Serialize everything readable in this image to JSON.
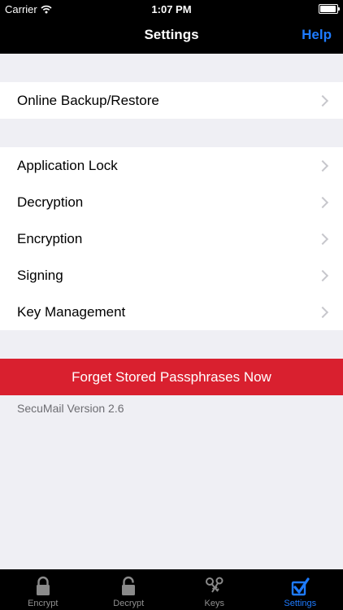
{
  "status": {
    "carrier": "Carrier",
    "time": "1:07 PM"
  },
  "nav": {
    "title": "Settings",
    "help": "Help"
  },
  "groups": {
    "backup": [
      "Online Backup/Restore"
    ],
    "main": [
      "Application Lock",
      "Decryption",
      "Encryption",
      "Signing",
      "Key Management"
    ]
  },
  "forget_button": "Forget Stored Passphrases Now",
  "version": "SecuMail Version 2.6",
  "tabs": [
    {
      "label": "Encrypt",
      "icon": "lock-icon"
    },
    {
      "label": "Decrypt",
      "icon": "unlocked-icon"
    },
    {
      "label": "Keys",
      "icon": "keys-icon"
    },
    {
      "label": "Settings",
      "icon": "checkbox-icon",
      "active": true
    }
  ],
  "colors": {
    "accent": "#1e7bff",
    "danger": "#d9202f",
    "background": "#efeff4"
  }
}
